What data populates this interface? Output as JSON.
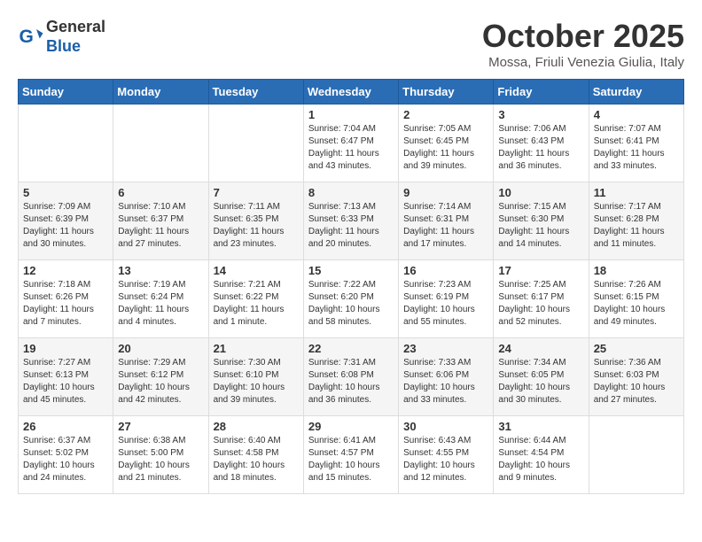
{
  "header": {
    "logo_general": "General",
    "logo_blue": "Blue",
    "month_title": "October 2025",
    "location": "Mossa, Friuli Venezia Giulia, Italy"
  },
  "days_of_week": [
    "Sunday",
    "Monday",
    "Tuesday",
    "Wednesday",
    "Thursday",
    "Friday",
    "Saturday"
  ],
  "weeks": [
    [
      {
        "day": "",
        "info": ""
      },
      {
        "day": "",
        "info": ""
      },
      {
        "day": "",
        "info": ""
      },
      {
        "day": "1",
        "info": "Sunrise: 7:04 AM\nSunset: 6:47 PM\nDaylight: 11 hours and 43 minutes."
      },
      {
        "day": "2",
        "info": "Sunrise: 7:05 AM\nSunset: 6:45 PM\nDaylight: 11 hours and 39 minutes."
      },
      {
        "day": "3",
        "info": "Sunrise: 7:06 AM\nSunset: 6:43 PM\nDaylight: 11 hours and 36 minutes."
      },
      {
        "day": "4",
        "info": "Sunrise: 7:07 AM\nSunset: 6:41 PM\nDaylight: 11 hours and 33 minutes."
      }
    ],
    [
      {
        "day": "5",
        "info": "Sunrise: 7:09 AM\nSunset: 6:39 PM\nDaylight: 11 hours and 30 minutes."
      },
      {
        "day": "6",
        "info": "Sunrise: 7:10 AM\nSunset: 6:37 PM\nDaylight: 11 hours and 27 minutes."
      },
      {
        "day": "7",
        "info": "Sunrise: 7:11 AM\nSunset: 6:35 PM\nDaylight: 11 hours and 23 minutes."
      },
      {
        "day": "8",
        "info": "Sunrise: 7:13 AM\nSunset: 6:33 PM\nDaylight: 11 hours and 20 minutes."
      },
      {
        "day": "9",
        "info": "Sunrise: 7:14 AM\nSunset: 6:31 PM\nDaylight: 11 hours and 17 minutes."
      },
      {
        "day": "10",
        "info": "Sunrise: 7:15 AM\nSunset: 6:30 PM\nDaylight: 11 hours and 14 minutes."
      },
      {
        "day": "11",
        "info": "Sunrise: 7:17 AM\nSunset: 6:28 PM\nDaylight: 11 hours and 11 minutes."
      }
    ],
    [
      {
        "day": "12",
        "info": "Sunrise: 7:18 AM\nSunset: 6:26 PM\nDaylight: 11 hours and 7 minutes."
      },
      {
        "day": "13",
        "info": "Sunrise: 7:19 AM\nSunset: 6:24 PM\nDaylight: 11 hours and 4 minutes."
      },
      {
        "day": "14",
        "info": "Sunrise: 7:21 AM\nSunset: 6:22 PM\nDaylight: 11 hours and 1 minute."
      },
      {
        "day": "15",
        "info": "Sunrise: 7:22 AM\nSunset: 6:20 PM\nDaylight: 10 hours and 58 minutes."
      },
      {
        "day": "16",
        "info": "Sunrise: 7:23 AM\nSunset: 6:19 PM\nDaylight: 10 hours and 55 minutes."
      },
      {
        "day": "17",
        "info": "Sunrise: 7:25 AM\nSunset: 6:17 PM\nDaylight: 10 hours and 52 minutes."
      },
      {
        "day": "18",
        "info": "Sunrise: 7:26 AM\nSunset: 6:15 PM\nDaylight: 10 hours and 49 minutes."
      }
    ],
    [
      {
        "day": "19",
        "info": "Sunrise: 7:27 AM\nSunset: 6:13 PM\nDaylight: 10 hours and 45 minutes."
      },
      {
        "day": "20",
        "info": "Sunrise: 7:29 AM\nSunset: 6:12 PM\nDaylight: 10 hours and 42 minutes."
      },
      {
        "day": "21",
        "info": "Sunrise: 7:30 AM\nSunset: 6:10 PM\nDaylight: 10 hours and 39 minutes."
      },
      {
        "day": "22",
        "info": "Sunrise: 7:31 AM\nSunset: 6:08 PM\nDaylight: 10 hours and 36 minutes."
      },
      {
        "day": "23",
        "info": "Sunrise: 7:33 AM\nSunset: 6:06 PM\nDaylight: 10 hours and 33 minutes."
      },
      {
        "day": "24",
        "info": "Sunrise: 7:34 AM\nSunset: 6:05 PM\nDaylight: 10 hours and 30 minutes."
      },
      {
        "day": "25",
        "info": "Sunrise: 7:36 AM\nSunset: 6:03 PM\nDaylight: 10 hours and 27 minutes."
      }
    ],
    [
      {
        "day": "26",
        "info": "Sunrise: 6:37 AM\nSunset: 5:02 PM\nDaylight: 10 hours and 24 minutes."
      },
      {
        "day": "27",
        "info": "Sunrise: 6:38 AM\nSunset: 5:00 PM\nDaylight: 10 hours and 21 minutes."
      },
      {
        "day": "28",
        "info": "Sunrise: 6:40 AM\nSunset: 4:58 PM\nDaylight: 10 hours and 18 minutes."
      },
      {
        "day": "29",
        "info": "Sunrise: 6:41 AM\nSunset: 4:57 PM\nDaylight: 10 hours and 15 minutes."
      },
      {
        "day": "30",
        "info": "Sunrise: 6:43 AM\nSunset: 4:55 PM\nDaylight: 10 hours and 12 minutes."
      },
      {
        "day": "31",
        "info": "Sunrise: 6:44 AM\nSunset: 4:54 PM\nDaylight: 10 hours and 9 minutes."
      },
      {
        "day": "",
        "info": ""
      }
    ]
  ]
}
